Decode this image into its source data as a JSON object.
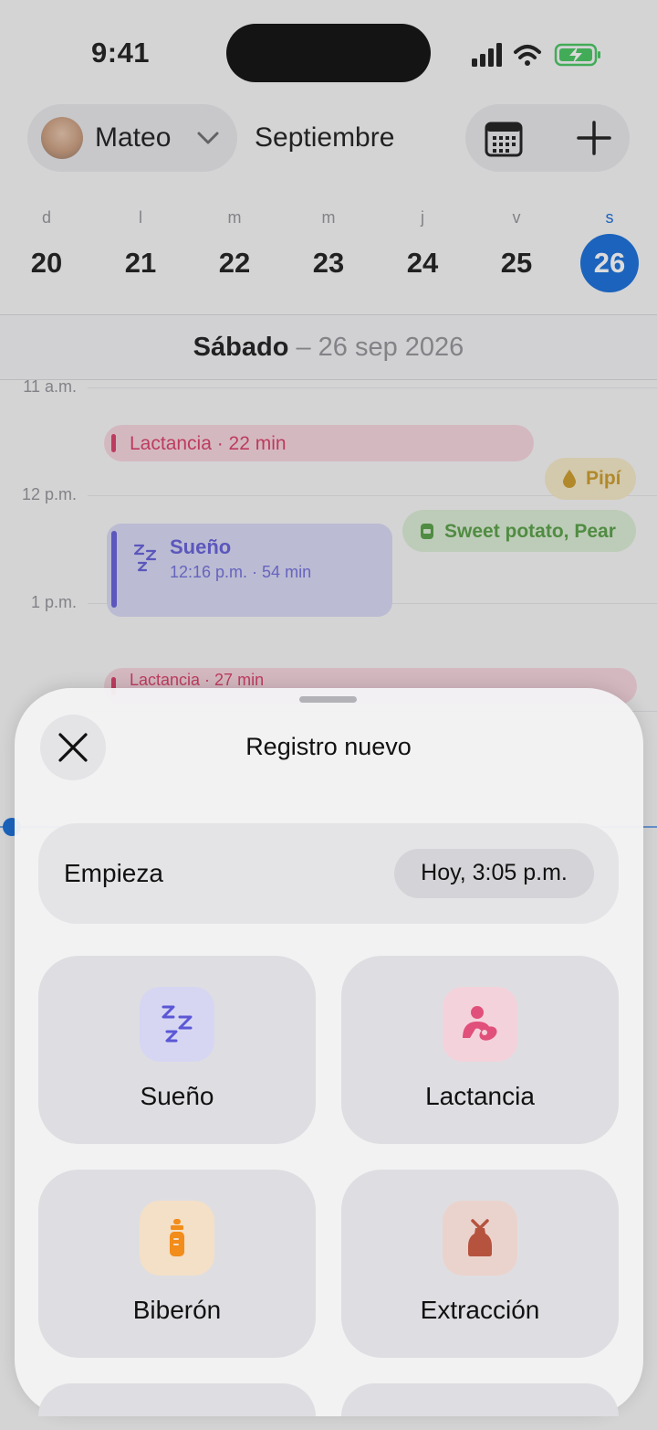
{
  "status": {
    "time": "9:41"
  },
  "header": {
    "child_name": "Mateo",
    "month": "Septiembre"
  },
  "week": {
    "days": [
      {
        "letter": "d",
        "num": "20"
      },
      {
        "letter": "l",
        "num": "21"
      },
      {
        "letter": "m",
        "num": "22"
      },
      {
        "letter": "m",
        "num": "23"
      },
      {
        "letter": "j",
        "num": "24"
      },
      {
        "letter": "v",
        "num": "25"
      },
      {
        "letter": "s",
        "num": "26"
      }
    ]
  },
  "day": {
    "weekday": "Sábado",
    "date": " – 26 sep 2026"
  },
  "timeline": {
    "hours": [
      "11 a.m.",
      "12 p.m.",
      "1 p.m."
    ],
    "events": {
      "lact1": "Lactancia · 22 min",
      "pipi": "Pipí",
      "food": "Sweet potato, Pear",
      "sleep_title": "Sueño",
      "sleep_sub": "12:16 p.m. · 54 min",
      "lact2": "Lactancia · 27 min"
    }
  },
  "sheet": {
    "title": "Registro nuevo",
    "start_label": "Empieza",
    "start_value": "Hoy, 3:05 p.m.",
    "tiles": [
      {
        "label": "Sueño",
        "icon": "sleep-zzz-icon",
        "color": "#5b57d6"
      },
      {
        "label": "Lactancia",
        "icon": "nursing-icon",
        "color": "#e0507a"
      },
      {
        "label": "Biberón",
        "icon": "bottle-icon",
        "color": "#f28c1a"
      },
      {
        "label": "Extracción",
        "icon": "breast-pump-icon",
        "color": "#b5533f"
      }
    ]
  },
  "colors": {
    "accent": "#0a66d6",
    "sleep": "#5b57d6",
    "nursing": "#d8345f",
    "diaper": "#c9971d",
    "food": "#4e9a3a"
  }
}
